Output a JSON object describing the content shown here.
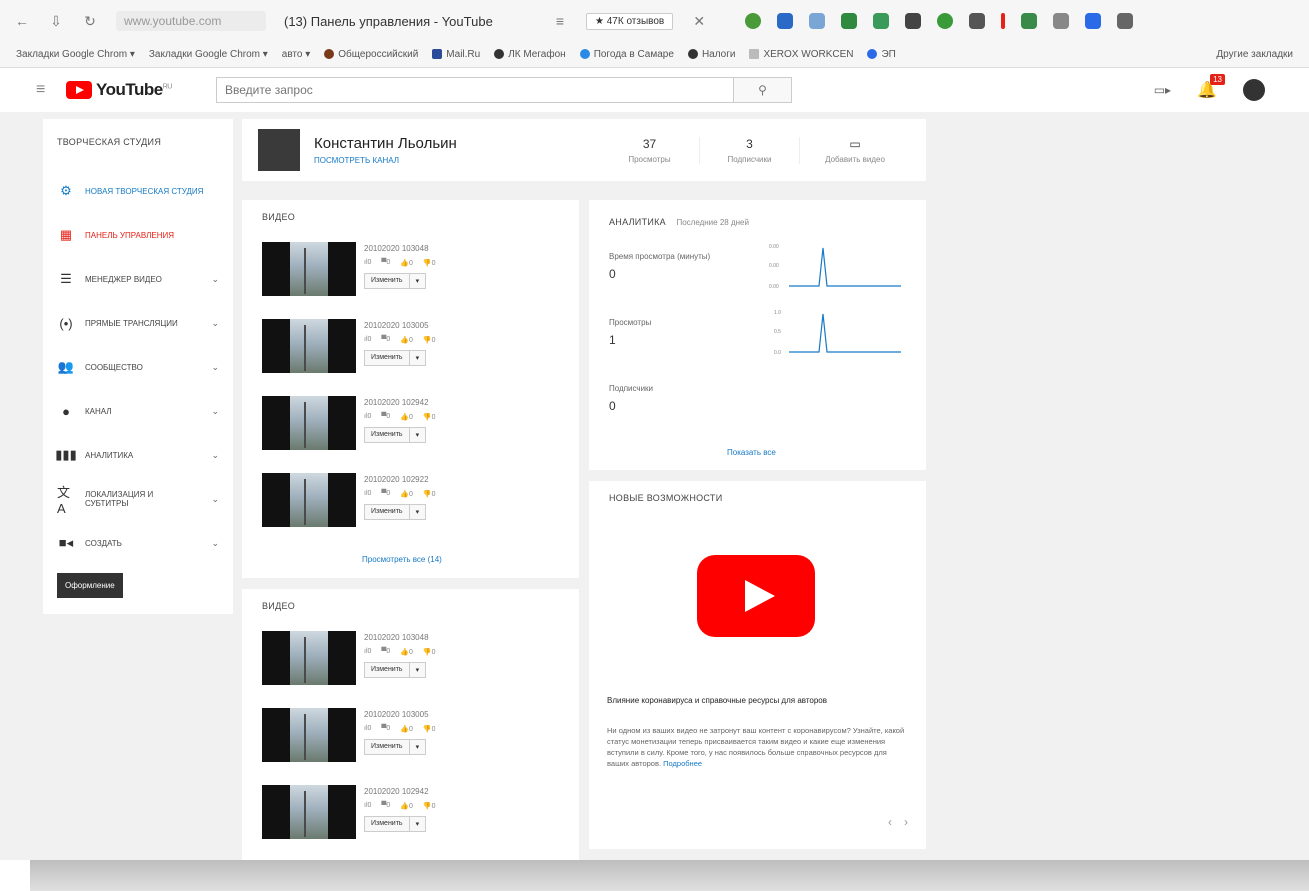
{
  "browser": {
    "url": "www.youtube.com",
    "tab_title": "(13) Панель управления - YouTube",
    "reviews_badge": "★ 47К отзывов"
  },
  "bookmarks": [
    "Закладки Google Chrom ▾",
    "Закладки Google Chrom ▾",
    "авто ▾",
    "Общероссийский",
    "Mail.Ru",
    "ЛК Мегафон",
    "Погода в Самаре",
    "Налоги",
    "XEROX WORKCEN",
    "ЭП",
    "Другие закладки"
  ],
  "yt_header": {
    "logo_text": "YouTube",
    "logo_region": "RU",
    "search_placeholder": "Введите запрос",
    "notification_count": "13"
  },
  "sidebar": {
    "heading": "ТВОРЧЕСКАЯ СТУДИЯ",
    "items": [
      {
        "label": "НОВАЯ ТВОРЧЕСКАЯ СТУДИЯ",
        "icon": "gear-icon"
      },
      {
        "label": "ПАНЕЛЬ УПРАВЛЕНИЯ",
        "icon": "dashboard-icon"
      },
      {
        "label": "МЕНЕДЖЕР ВИДЕО",
        "icon": "video-manager-icon"
      },
      {
        "label": "ПРЯМЫЕ ТРАНСЛЯЦИИ",
        "icon": "live-icon"
      },
      {
        "label": "СООБЩЕСТВО",
        "icon": "community-icon"
      },
      {
        "label": "КАНАЛ",
        "icon": "channel-icon"
      },
      {
        "label": "АНАЛИТИКА",
        "icon": "analytics-icon"
      },
      {
        "label": "ЛОКАЛИЗАЦИЯ И СУБТИТРЫ",
        "icon": "translate-icon"
      },
      {
        "label": "СОЗДАТЬ",
        "icon": "create-icon"
      }
    ],
    "classic_button": "Оформление"
  },
  "channel": {
    "name": "Константин Льольин",
    "link": "ПОСМОТРЕТЬ КАНАЛ",
    "views": "37",
    "views_label": "Просмотры",
    "subs": "3",
    "subs_label": "Подписчики",
    "add_label": "Добавить видео"
  },
  "videos_card_1": {
    "title": "ВИДЕО",
    "items": [
      {
        "date": "20102020 103048",
        "edit": "Изменить"
      },
      {
        "date": "20102020 103005",
        "edit": "Изменить"
      },
      {
        "date": "20102020 102942",
        "edit": "Изменить"
      },
      {
        "date": "20102020 102922",
        "edit": "Изменить"
      }
    ],
    "see_all": "Просмотреть все (14)"
  },
  "videos_card_2": {
    "title": "ВИДЕО",
    "items": [
      {
        "date": "20102020 103048",
        "edit": "Изменить"
      },
      {
        "date": "20102020 103005",
        "edit": "Изменить"
      },
      {
        "date": "20102020 102942",
        "edit": "Изменить"
      }
    ]
  },
  "video_stats": {
    "views": "0",
    "comments": "0",
    "likes": "0",
    "dislikes": "0"
  },
  "analytics": {
    "title": "АНАЛИТИКА",
    "subtitle": "Последние 28 дней",
    "metrics": [
      {
        "label": "Время просмотра (минуты)",
        "value": "0"
      },
      {
        "label": "Просмотры",
        "value": "1"
      },
      {
        "label": "Подписчики",
        "value": "0"
      }
    ],
    "see_all": "Показать все"
  },
  "whats_new": {
    "title": "НОВЫЕ ВОЗМОЖНОСТИ",
    "news_title": "Влияние коронавируса и справочные ресурсы для авторов",
    "news_body": "Ни одном из ваших видео не затронут ваш контент с коронавирусом? Узнайте, какой статус монетизации теперь присваивается таким видео и какие еще изменения вступили в силу. Кроме того, у нас появилось больше справочных ресурсов для ваших авторов.",
    "news_more": "Подробнее"
  },
  "colors": {
    "accent": "#167ac6",
    "brand": "#ff0000",
    "alert": "#e62117"
  }
}
